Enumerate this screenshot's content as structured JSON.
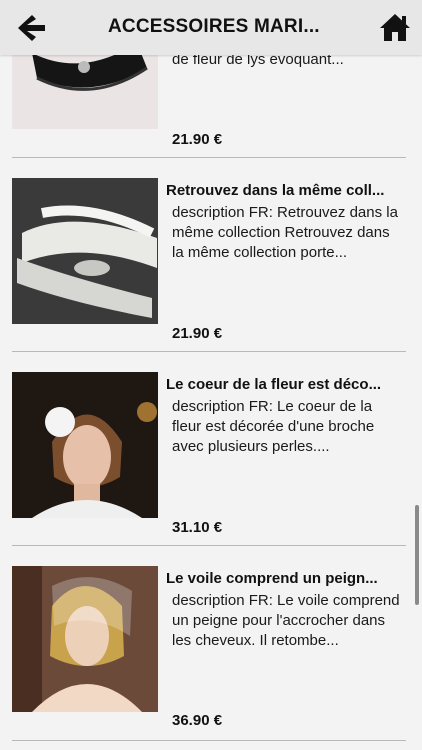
{
  "header": {
    "title": "ACCESSOIRES MARI...",
    "back_icon": "arrow-left-icon",
    "home_icon": "home-icon"
  },
  "products": [
    {
      "title": "",
      "description": "de fleur de lys évoquant...",
      "price": "21.90 €"
    },
    {
      "title": "Retrouvez dans la même coll...",
      "description": "description FR: Retrouvez dans la même collection Retrouvez dans la même collection porte...",
      "price": "21.90 €"
    },
    {
      "title": "Le coeur de la fleur est déco...",
      "description": "description FR: Le coeur de la fleur est décorée d'une broche avec plusieurs perles....",
      "price": "31.10 €"
    },
    {
      "title": "Le voile comprend un peign...",
      "description": "description FR: Le voile comprend un peigne pour l'accrocher dans les cheveux. Il retombe...",
      "price": "36.90 €"
    }
  ]
}
